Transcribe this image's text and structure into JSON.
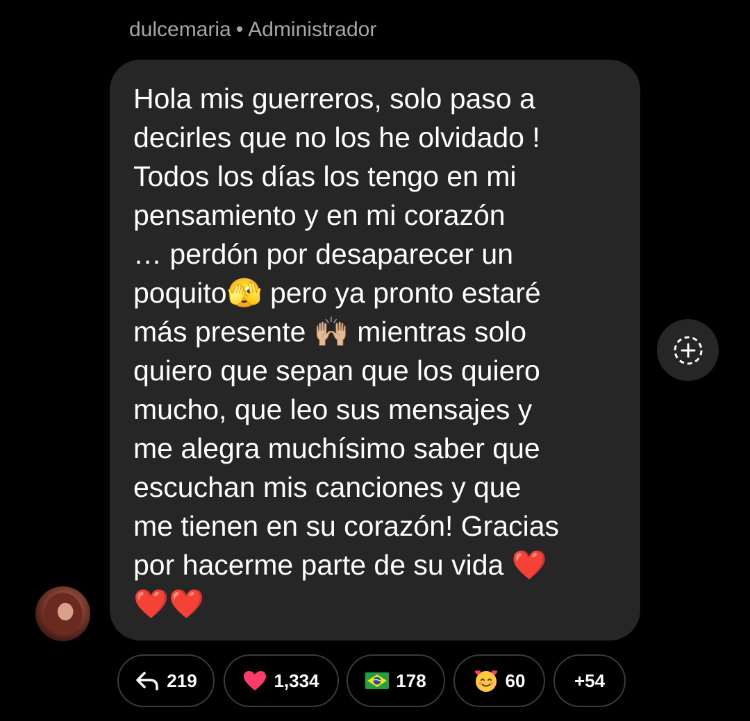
{
  "header": {
    "username": "dulcemaria",
    "separator": "•",
    "role": "Administrador"
  },
  "message": {
    "text": "Hola mis guerreros, solo paso a\ndecirles que no los he olvidado !\nTodos los días los tengo en mi\npensamiento y en mi corazón\n… perdón por desaparecer un\npoquito🫣 pero ya pronto estaré\nmás presente 🙌🏼 mientras solo\nquiero que sepan que los quiero\nmucho, que leo sus mensajes y\nme alegra muchísimo saber que\nescuchan mis canciones y que\nme tienen en su corazón! Gracias\npor hacerme parte de su vida ❤️\n❤️❤️"
  },
  "reactions": {
    "replies": {
      "icon": "reply-arrow-icon",
      "count": "219"
    },
    "heart": {
      "icon": "heart-icon",
      "count": "1,334"
    },
    "flag": {
      "icon": "brazil-flag-icon",
      "count": "178"
    },
    "smile": {
      "icon": "smiling-face-with-hearts-icon",
      "count": "60"
    },
    "more": {
      "label": "+54"
    }
  },
  "colors": {
    "background": "#000000",
    "bubble": "#262626",
    "muted_text": "#a6a6a6",
    "pill_border": "#3a3a3a",
    "heart": "#ff3b6b"
  }
}
